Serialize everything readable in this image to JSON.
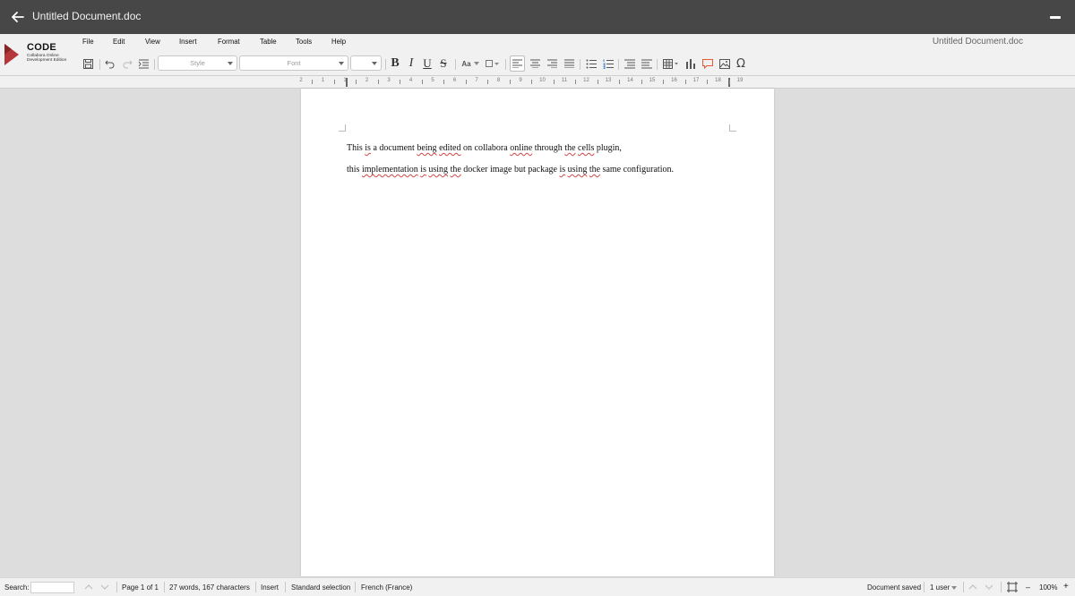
{
  "window": {
    "title": "Untitled Document.doc"
  },
  "header": {
    "doc_name": "Untitled Document.doc",
    "logo": {
      "name": "CODE",
      "subtitle_line1": "Collabora Online",
      "subtitle_line2": "Development Edition"
    }
  },
  "menu": [
    "File",
    "Edit",
    "View",
    "Insert",
    "Format",
    "Table",
    "Tools",
    "Help"
  ],
  "toolbar": {
    "style_placeholder": "Style",
    "font_placeholder": "Font",
    "size_value": "",
    "bold": "B",
    "italic": "I",
    "underline": "U",
    "strike": "S",
    "case": "Aa",
    "special_char": "Ω"
  },
  "ruler": {
    "numbers": [
      "2",
      "1",
      "1",
      "2",
      "3",
      "4",
      "5",
      "6",
      "7",
      "8",
      "9",
      "10",
      "11",
      "12",
      "13",
      "14",
      "15",
      "16",
      "17",
      "18",
      "19"
    ]
  },
  "document": {
    "paragraphs": [
      "This is a document being edited on collabora online through the cells plugin,",
      "this implementation is using the docker image but package is using the same configuration."
    ]
  },
  "status": {
    "search_label": "Search:",
    "search_value": "",
    "page": "Page 1 of 1",
    "words": "27 words, 167 characters",
    "mode": "Insert",
    "selection": "Standard selection",
    "language": "French (France)",
    "saved": "Document saved",
    "users": "1 user",
    "zoom": "100%",
    "zoom_out": "–",
    "zoom_in": "+"
  },
  "colors": {
    "titlebar": "#474747",
    "toolbar": "#f1f1f1",
    "logo_red": "#b5373a",
    "spell_underline": "#d04545"
  }
}
